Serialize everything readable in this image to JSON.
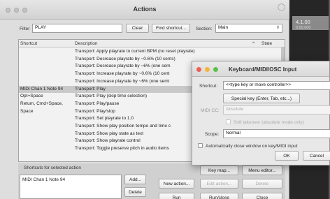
{
  "window": {
    "title": "Actions",
    "filter_label": "Filter",
    "filter_value": "PLAY",
    "clear_label": "Clear",
    "find_shortcut_label": "Find shortcut...",
    "section_label": "Section:",
    "section_value": "Main"
  },
  "list": {
    "headers": {
      "shortcut": "Shortcut",
      "description": "Description",
      "state": "State"
    },
    "sort_indicator": "^",
    "rows": [
      {
        "shortcut": "",
        "description": "Transport: Apply playrate to current BPM (no reset playrate)"
      },
      {
        "shortcut": "",
        "description": "Transport: Decrease playrate by ~0.6% (10 cents)"
      },
      {
        "shortcut": "",
        "description": "Transport: Decrease playrate by ~6% (one sem"
      },
      {
        "shortcut": "",
        "description": "Transport: Increase playrate by ~0.6% (10 cent"
      },
      {
        "shortcut": "",
        "description": "Transport: Increase playrate by ~6% (one semi"
      },
      {
        "shortcut": "MIDI Chan 1 Note 94",
        "description": "Transport: Play"
      },
      {
        "shortcut": "Opt+Space",
        "description": "Transport: Play (skip time selection)"
      },
      {
        "shortcut": "Return, Cmd+Space,",
        "description": "Transport: Play/pause"
      },
      {
        "shortcut": "Space",
        "description": "Transport: Play/stop"
      },
      {
        "shortcut": "",
        "description": "Transport: Set playrate to 1.0"
      },
      {
        "shortcut": "",
        "description": "Transport: Show play position tempo and time c"
      },
      {
        "shortcut": "",
        "description": "Transport: Show play state as text"
      },
      {
        "shortcut": "",
        "description": "Transport: Show playrate control"
      },
      {
        "shortcut": "",
        "description": "Transport: Toggle preserve pitch in audio items"
      }
    ]
  },
  "lower": {
    "shortcuts_for_label": "Shortcuts for selected action",
    "shortcut_item": "MIDI Chan 1 Note 94",
    "add_label": "Add...",
    "delete_label": "Delete",
    "new_action_label": "New action...",
    "run_label": "Run",
    "keymap_label": "Key map...",
    "edit_action_label": "Edit action...",
    "run_close_label": "Run/close",
    "menu_editor_label": "Menu editor...",
    "delete_action_label": "Delete",
    "close_label": "Close"
  },
  "dialog": {
    "title": "Keyboard/MIDI/OSC Input",
    "shortcut_label": "Shortcut:",
    "shortcut_value": "<<type key or move controller>>",
    "special_key_label": "Special key (Enter, Tab, etc...)",
    "midi_cc_label": "MIDI CC:",
    "midi_cc_value": "Absolute",
    "soft_takeover_label": "Soft takeover (absolute mode only)",
    "scope_label": "Scope:",
    "scope_value": "Normal",
    "auto_close_label": "Automatically close window on key/MIDI input",
    "ok_label": "OK",
    "cancel_label": "Cancel",
    "traffic_colors": [
      "#ec5f56",
      "#f2b63b",
      "#5dc149"
    ]
  },
  "background": {
    "right_value": "4.1.00",
    "right_sub": "0.00.000"
  },
  "colors": {
    "highlight_row": "#c9c9c9"
  }
}
